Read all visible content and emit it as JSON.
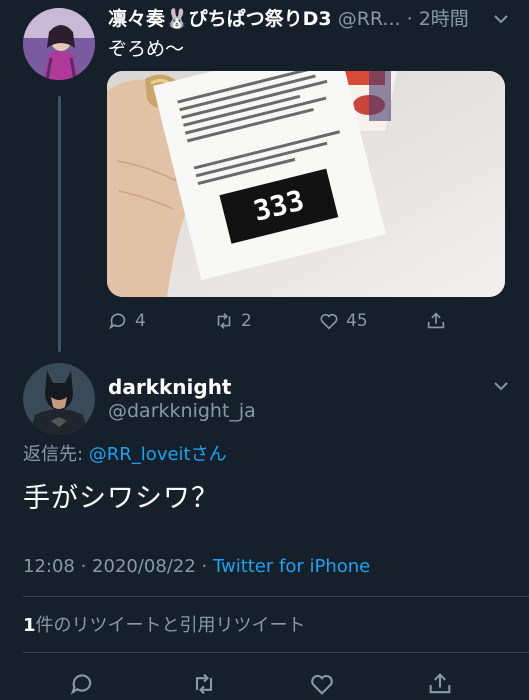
{
  "tweet1": {
    "display_name": "凛々奏🐰ぴちぱつ祭りD3",
    "handle": "@RR...",
    "time": "2時間",
    "text": "ぞろめ〜",
    "media": {
      "ticket_number": "333"
    },
    "actions": {
      "replies": "4",
      "retweets": "2",
      "likes": "45"
    }
  },
  "tweet2": {
    "display_name": "darkknight",
    "handle": "@darkknight_ja",
    "reply_prefix": "返信先: ",
    "reply_mention": "@RR_loveit",
    "reply_suffix": "さん",
    "text": "手がシワシワ？",
    "timestamp": "12:08 · 2020/08/22 · ",
    "client": "Twitter for iPhone",
    "retweet_count": "1",
    "retweet_label": "件のリツイートと引用リツイート"
  },
  "colors": {
    "background": "#15202b",
    "muted": "#8899a6",
    "link": "#1da1f2",
    "divider": "#38444d"
  }
}
